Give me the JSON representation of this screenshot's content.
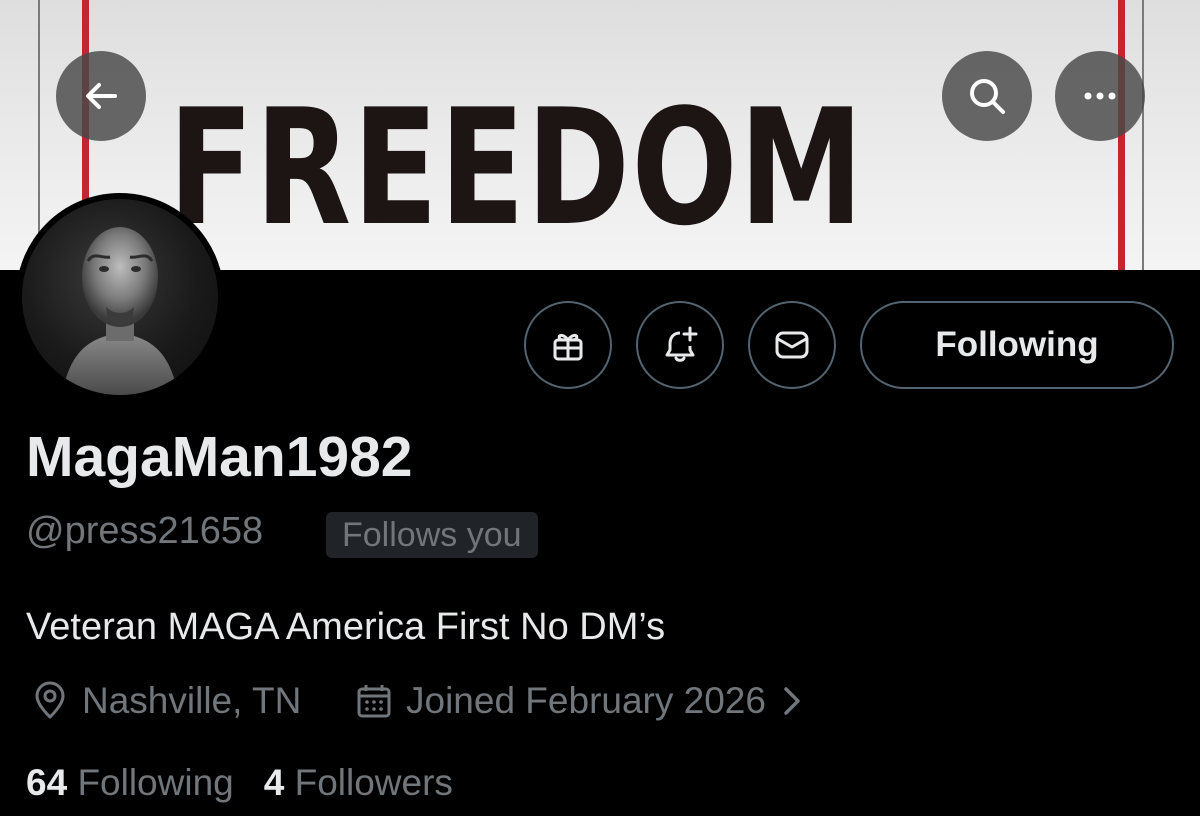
{
  "banner": {
    "text": "FREEDOM",
    "icon_name": "banner-image"
  },
  "header": {
    "back_icon": "back-arrow-icon",
    "search_icon": "search-icon",
    "more_icon": "more-icon"
  },
  "profile": {
    "display_name": "MagaMan1982",
    "handle": "@press21658",
    "follows_you": "Follows you",
    "bio": "Veteran MAGA America First No DM’s",
    "location": "Nashville, TN",
    "joined": "Joined February 2026",
    "following_count": "64",
    "following_label": "Following",
    "followers_count": "4",
    "followers_label": "Followers"
  },
  "actions": {
    "gift_icon": "gift-icon",
    "notify_icon": "bell-plus-icon",
    "message_icon": "mail-icon",
    "follow_state_label": "Following"
  },
  "colors": {
    "background": "#000000",
    "text_primary": "#e7e9ea",
    "text_secondary": "#71767b",
    "border": "#536471",
    "banner_red": "#c1272d"
  }
}
